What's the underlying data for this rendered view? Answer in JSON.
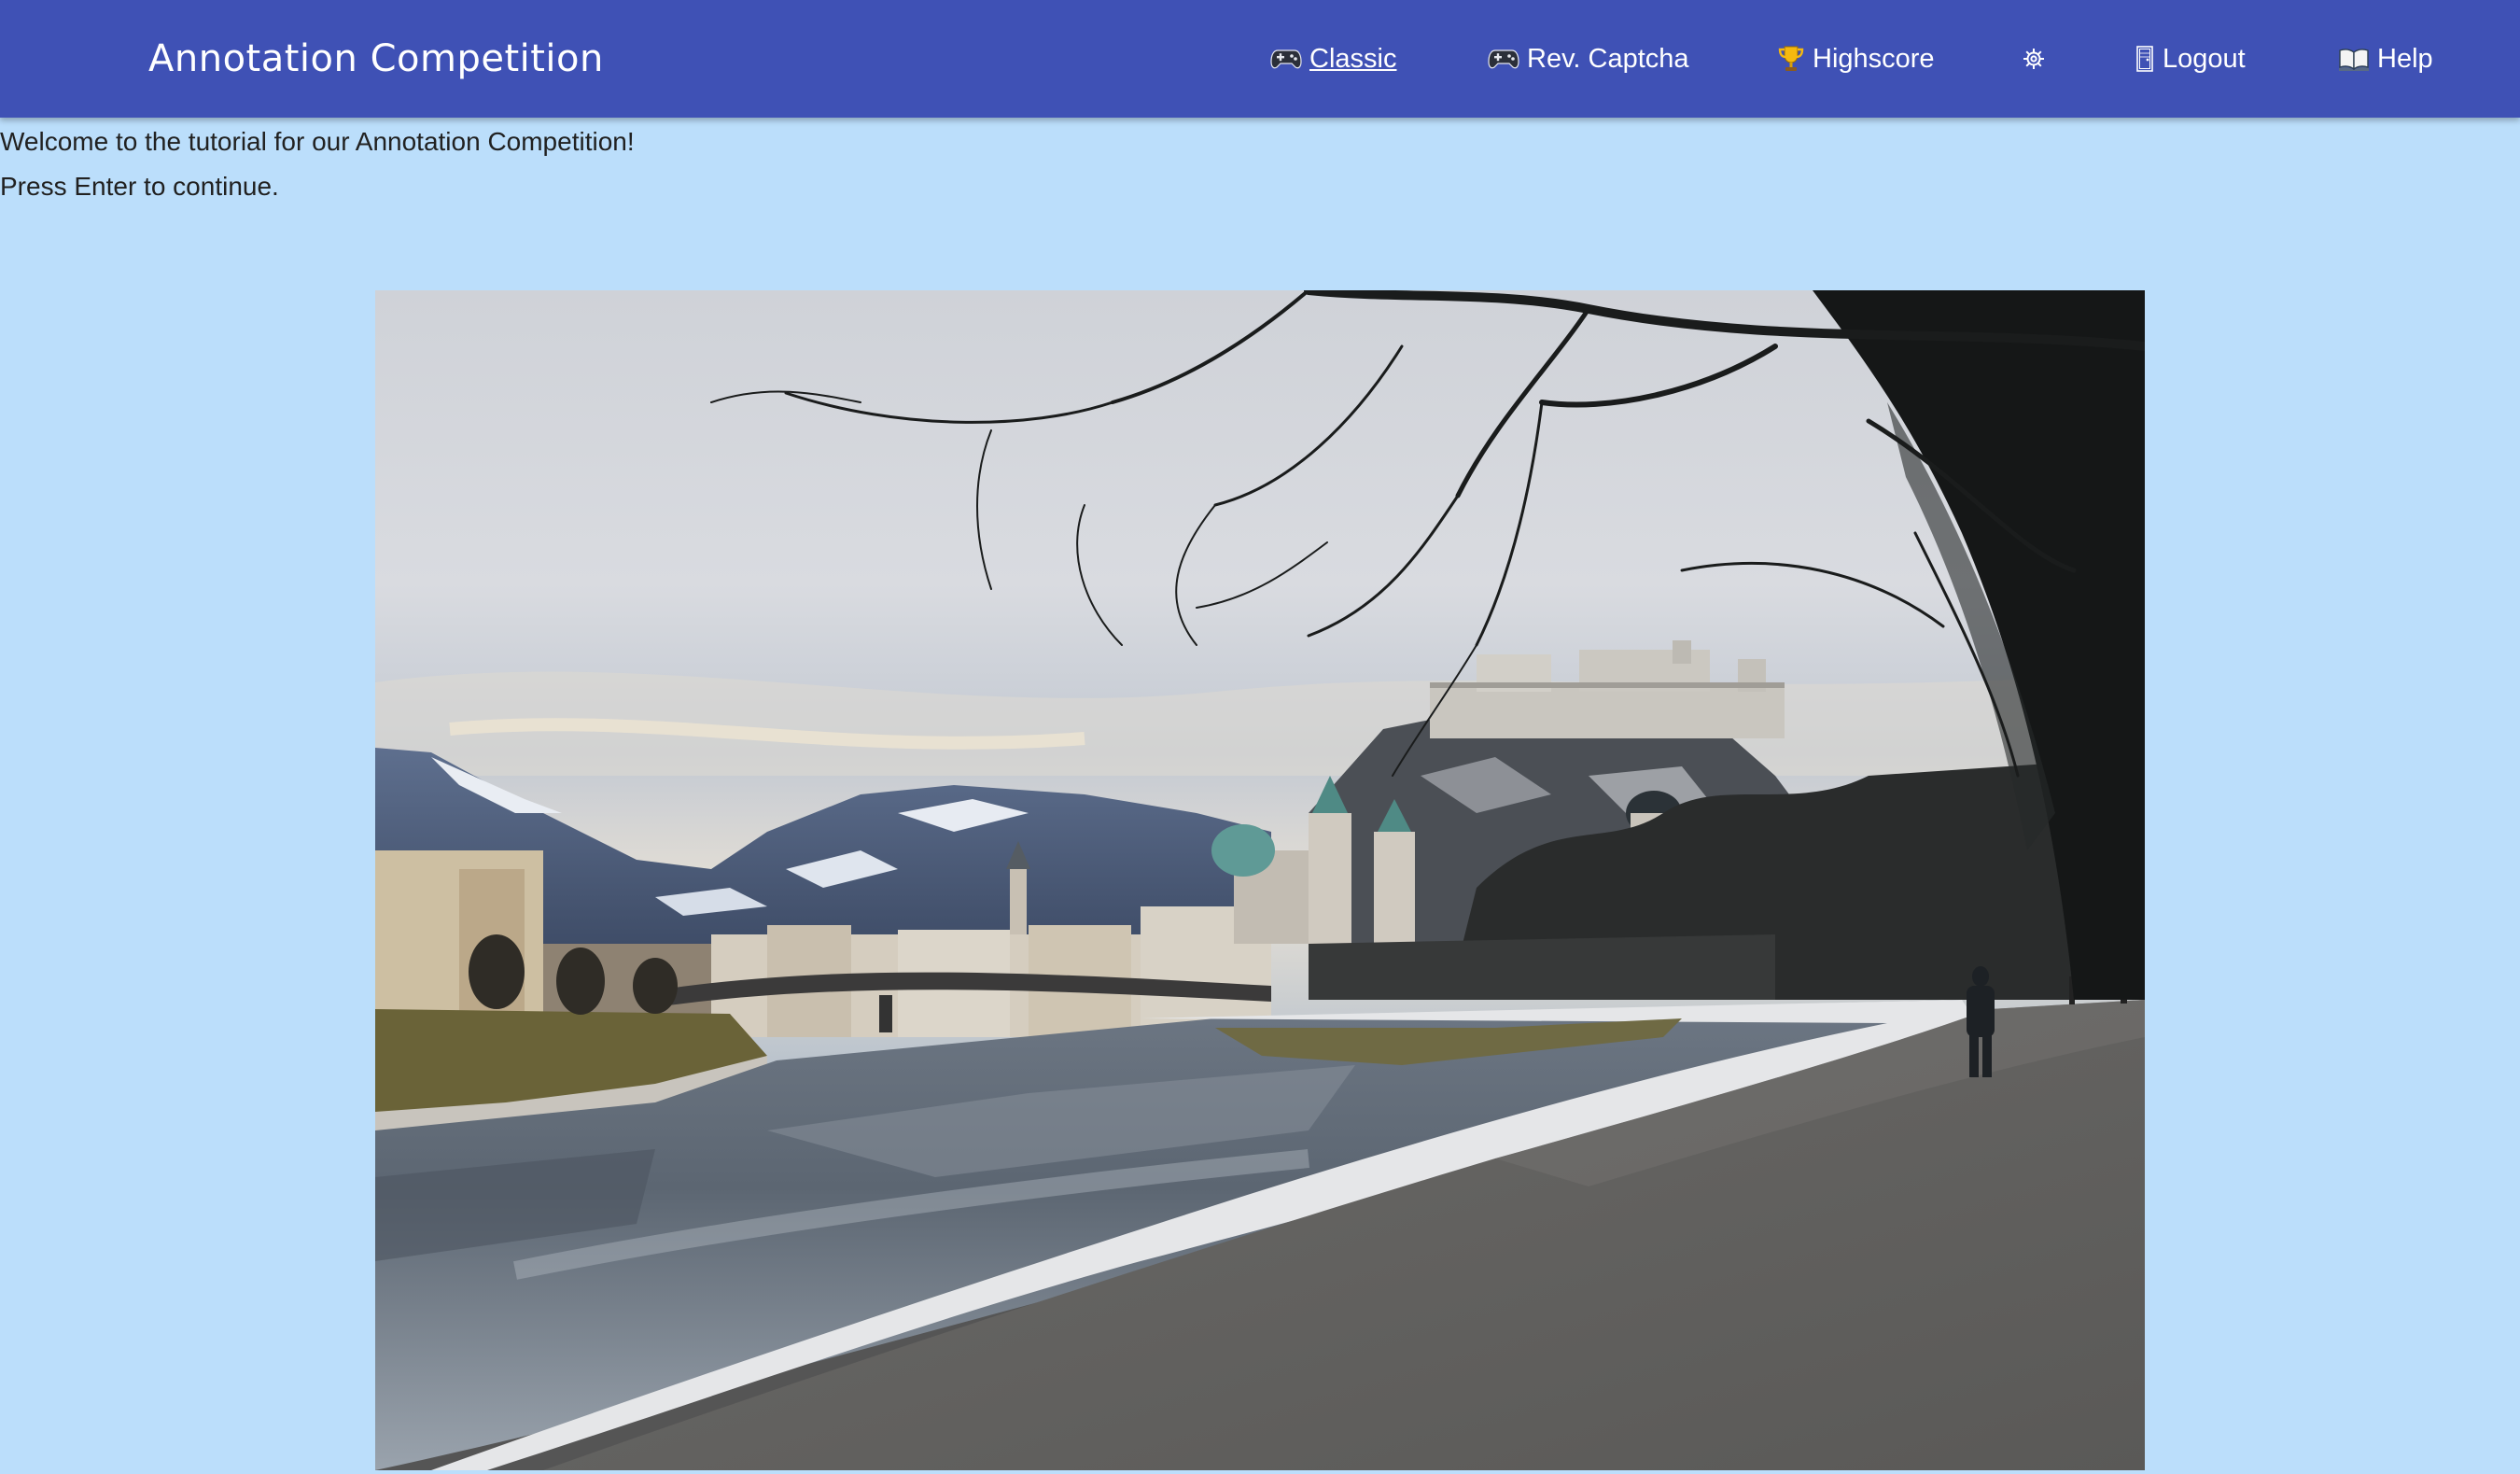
{
  "app": {
    "title": "Annotation Competition"
  },
  "nav": {
    "items": [
      {
        "label": "Classic",
        "icon": "gamepad-icon",
        "active": true
      },
      {
        "label": "Rev. Captcha",
        "icon": "gamepad-icon",
        "active": false
      },
      {
        "label": "Highscore",
        "icon": "trophy-icon",
        "active": false
      },
      {
        "label": "",
        "icon": "gear-icon",
        "active": false
      },
      {
        "label": "Logout",
        "icon": "door-icon",
        "active": false
      },
      {
        "label": "Help",
        "icon": "book-icon",
        "active": false
      }
    ]
  },
  "tutorial": {
    "welcome": "Welcome to the tutorial for our Annotation Competition!",
    "instruction": "Press Enter to continue."
  },
  "image": {
    "subject": "river-city-landscape-photo"
  },
  "colors": {
    "navbar": "#3f51b5",
    "background": "#bbdefb",
    "text": "#212121"
  }
}
